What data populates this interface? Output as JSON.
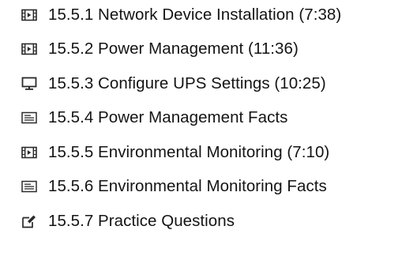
{
  "lessons": [
    {
      "icon": "video-icon",
      "label": "15.5.1 Network Device Installation (7:38)"
    },
    {
      "icon": "video-icon",
      "label": "15.5.2 Power Management (11:36)"
    },
    {
      "icon": "lab-simulation-icon",
      "label": "15.5.3 Configure UPS Settings (10:25)"
    },
    {
      "icon": "text-document-icon",
      "label": "15.5.4 Power Management Facts"
    },
    {
      "icon": "video-icon",
      "label": "15.5.5 Environmental Monitoring (7:10)"
    },
    {
      "icon": "text-document-icon",
      "label": "15.5.6 Environmental Monitoring Facts"
    },
    {
      "icon": "practice-questions-icon",
      "label": "15.5.7 Practice Questions"
    }
  ]
}
